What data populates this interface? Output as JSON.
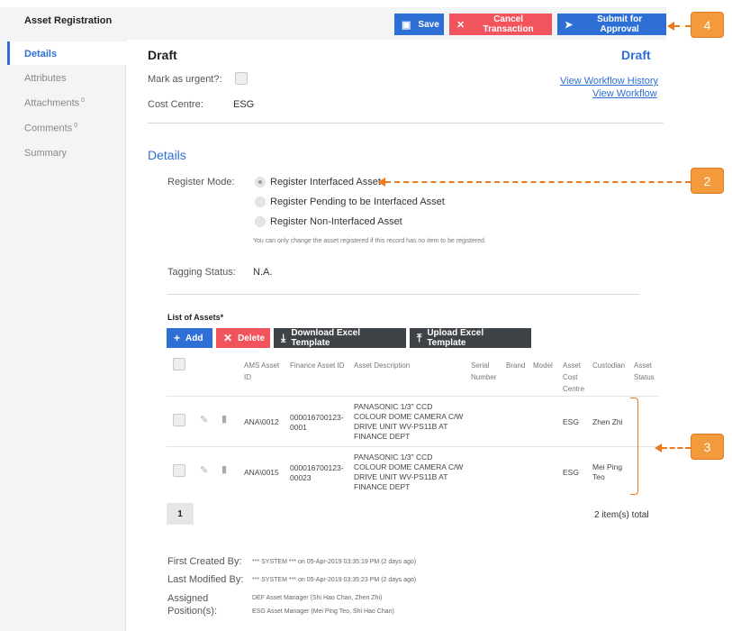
{
  "app": {
    "title": "Asset Registration"
  },
  "toolbar": {
    "save_label": "Save",
    "cancel_label": "Cancel Transaction",
    "submit_label": "Submit for Approval"
  },
  "sidebar": {
    "items": [
      {
        "label": "Details",
        "badge": ""
      },
      {
        "label": "Attributes",
        "badge": ""
      },
      {
        "label": "Attachments",
        "badge": "0"
      },
      {
        "label": "Comments",
        "badge": "0"
      },
      {
        "label": "Summary",
        "badge": ""
      }
    ]
  },
  "header": {
    "title": "Draft",
    "status": "Draft",
    "view_history_link": "View Workflow History",
    "view_workflow_link": "View Workflow",
    "mark_urgent_label": "Mark as urgent?:",
    "cost_centre_label": "Cost Centre:",
    "cost_centre_value": "ESG"
  },
  "details": {
    "section_title": "Details",
    "register_mode_label": "Register Mode:",
    "register_options": [
      {
        "label": "Register Interfaced Asset",
        "selected": true
      },
      {
        "label": "Register Pending to be Interfaced Asset",
        "selected": false
      },
      {
        "label": "Register Non-Interfaced Asset",
        "selected": false
      }
    ],
    "register_note": "You can only change the asset registered if this record has no item to be registered.",
    "tagging_status_label": "Tagging Status:",
    "tagging_status_value": "N.A."
  },
  "assets": {
    "list_title": "List of Assets*",
    "buttons": {
      "add": "Add",
      "delete": "Delete",
      "download": "Download Excel Template",
      "upload": "Upload Excel Template"
    },
    "columns": [
      "AMS Asset ID",
      "Finance Asset ID",
      "Asset Description",
      "Serial Number",
      "Brand",
      "Model",
      "Asset Cost Centre",
      "Custodian",
      "Asset Status"
    ],
    "rows": [
      {
        "ams_id": "ANA\\0012",
        "finance_id": "000016700123-0001",
        "description": "PANASONIC 1/3\" CCD COLOUR DOME CAMERA C/W DRIVE UNIT WV-PS11B AT FINANCE DEPT",
        "cost_centre": "ESG",
        "custodian": "Zhen Zhi"
      },
      {
        "ams_id": "ANA\\0015",
        "finance_id": "000016700123-00023",
        "description": "PANASONIC 1/3\" CCD COLOUR DOME CAMERA C/W DRIVE UNIT WV-PS11B AT FINANCE DEPT",
        "cost_centre": "ESG",
        "custodian": "Mei Ping Teo"
      }
    ],
    "page": "1",
    "total": "2 item(s) total"
  },
  "footer": {
    "created_label": "First Created By:",
    "created_value": "*** SYSTEM *** on 05-Apr-2019 03:35:19 PM (2 days ago)",
    "modified_label": "Last Modified By:",
    "modified_value": "*** SYSTEM *** on 05-Apr-2019 03:35:23 PM (2 days ago)",
    "assigned_label": "Assigned Position(s):",
    "assigned_values": [
      "DEF Asset Manager (Shi Hao Chan, Zhen Zhi)",
      "ESG Asset Manager (Mei Ping Teo, Shi Hao Chan)"
    ]
  },
  "callouts": {
    "c2": "2",
    "c3": "3",
    "c4": "4"
  },
  "colors": {
    "accent": "#2e6fd6",
    "danger": "#f1545c",
    "dark": "#3e4348",
    "callout": "#f39a3d"
  }
}
